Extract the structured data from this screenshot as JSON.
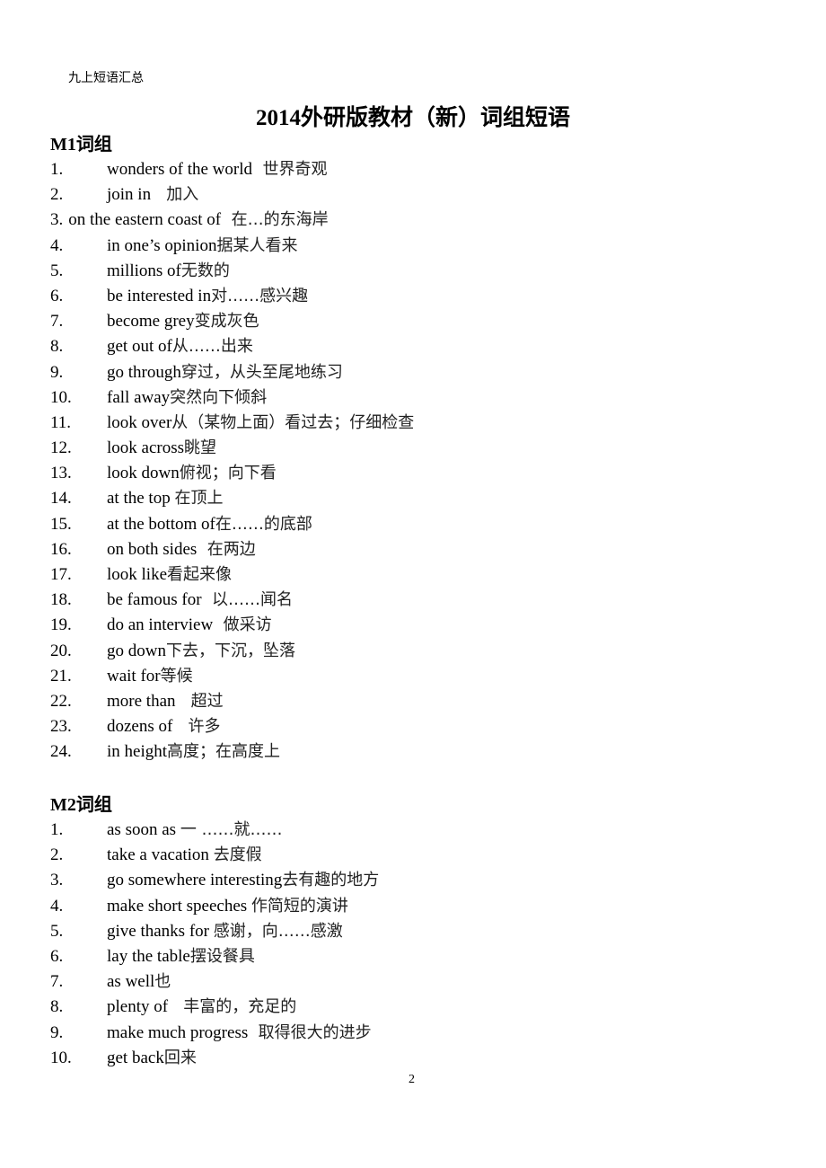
{
  "header_note": "九上短语汇总",
  "title": "2014外研版教材（新）词组短语",
  "sections": [
    {
      "heading": "M1词组",
      "items": [
        {
          "n": "1.",
          "en": "wonders of the world",
          "zh": "  世界奇观"
        },
        {
          "n": "2.",
          "en": "join in",
          "zh": "   加入"
        },
        {
          "n": "3.",
          "en": "on the eastern coast of",
          "zh": "  在…的东海岸",
          "inline": true
        },
        {
          "n": "4.",
          "en": "in one’s opinion",
          "zh": "据某人看来"
        },
        {
          "n": "5.",
          "en": "millions of",
          "zh": "无数的"
        },
        {
          "n": "6.",
          "en": "be interested in",
          "zh": "对……感兴趣"
        },
        {
          "n": "7.",
          "en": "become grey",
          "zh": "变成灰色"
        },
        {
          "n": "8.",
          "en": "get out of",
          "zh": "从……出来"
        },
        {
          "n": "9.",
          "en": "go through",
          "zh": "穿过，从头至尾地练习"
        },
        {
          "n": "10.",
          "en": "fall away",
          "zh": "突然向下倾斜"
        },
        {
          "n": "11.",
          "en": "look over",
          "zh": "从（某物上面）看过去；仔细检查"
        },
        {
          "n": "12.",
          "en": "look across",
          "zh": "眺望"
        },
        {
          "n": "13.",
          "en": "look down",
          "zh": "俯视；向下看"
        },
        {
          "n": "14.",
          "en": "at the top ",
          "zh": "在顶上"
        },
        {
          "n": "15.",
          "en": "at the bottom of",
          "zh": "在……的底部"
        },
        {
          "n": "16.",
          "en": "on both sides",
          "zh": "  在两边"
        },
        {
          "n": "17.",
          "en": "look like",
          "zh": "看起来像"
        },
        {
          "n": "18.",
          "en": "be famous for",
          "zh": "  以……闻名"
        },
        {
          "n": "19.",
          "en": "do an interview",
          "zh": "  做采访"
        },
        {
          "n": "20.",
          "en": "go down",
          "zh": "下去，下沉，坠落"
        },
        {
          "n": "21.",
          "en": "wait for",
          "zh": "等候"
        },
        {
          "n": "22.",
          "en": "more than",
          "zh": "   超过"
        },
        {
          "n": "23.",
          "en": "dozens of",
          "zh": "   许多"
        },
        {
          "n": "24.",
          "en": "in height",
          "zh": "高度；在高度上"
        }
      ]
    },
    {
      "heading": "M2词组",
      "items": [
        {
          "n": "1.",
          "en": "as soon as ",
          "zh": "一 ……就……"
        },
        {
          "n": "2.",
          "en": "take a vacation ",
          "zh": "去度假"
        },
        {
          "n": "3.",
          "en": "go somewhere interesting",
          "zh": "去有趣的地方"
        },
        {
          "n": "4.",
          "en": "make short speeches ",
          "zh": "作简短的演讲"
        },
        {
          "n": "5.",
          "en": "give thanks for ",
          "zh": "感谢，向……感激"
        },
        {
          "n": "6.",
          "en": "lay the table",
          "zh": "摆设餐具"
        },
        {
          "n": "7.",
          "en": "as well",
          "zh": "也"
        },
        {
          "n": "8.",
          "en": "plenty of",
          "zh": "   丰富的，充足的"
        },
        {
          "n": "9.",
          "en": "make much progress",
          "zh": "  取得很大的进步"
        },
        {
          "n": "10.",
          "en": "get back",
          "zh": "回来"
        }
      ]
    }
  ],
  "page_number": "2"
}
